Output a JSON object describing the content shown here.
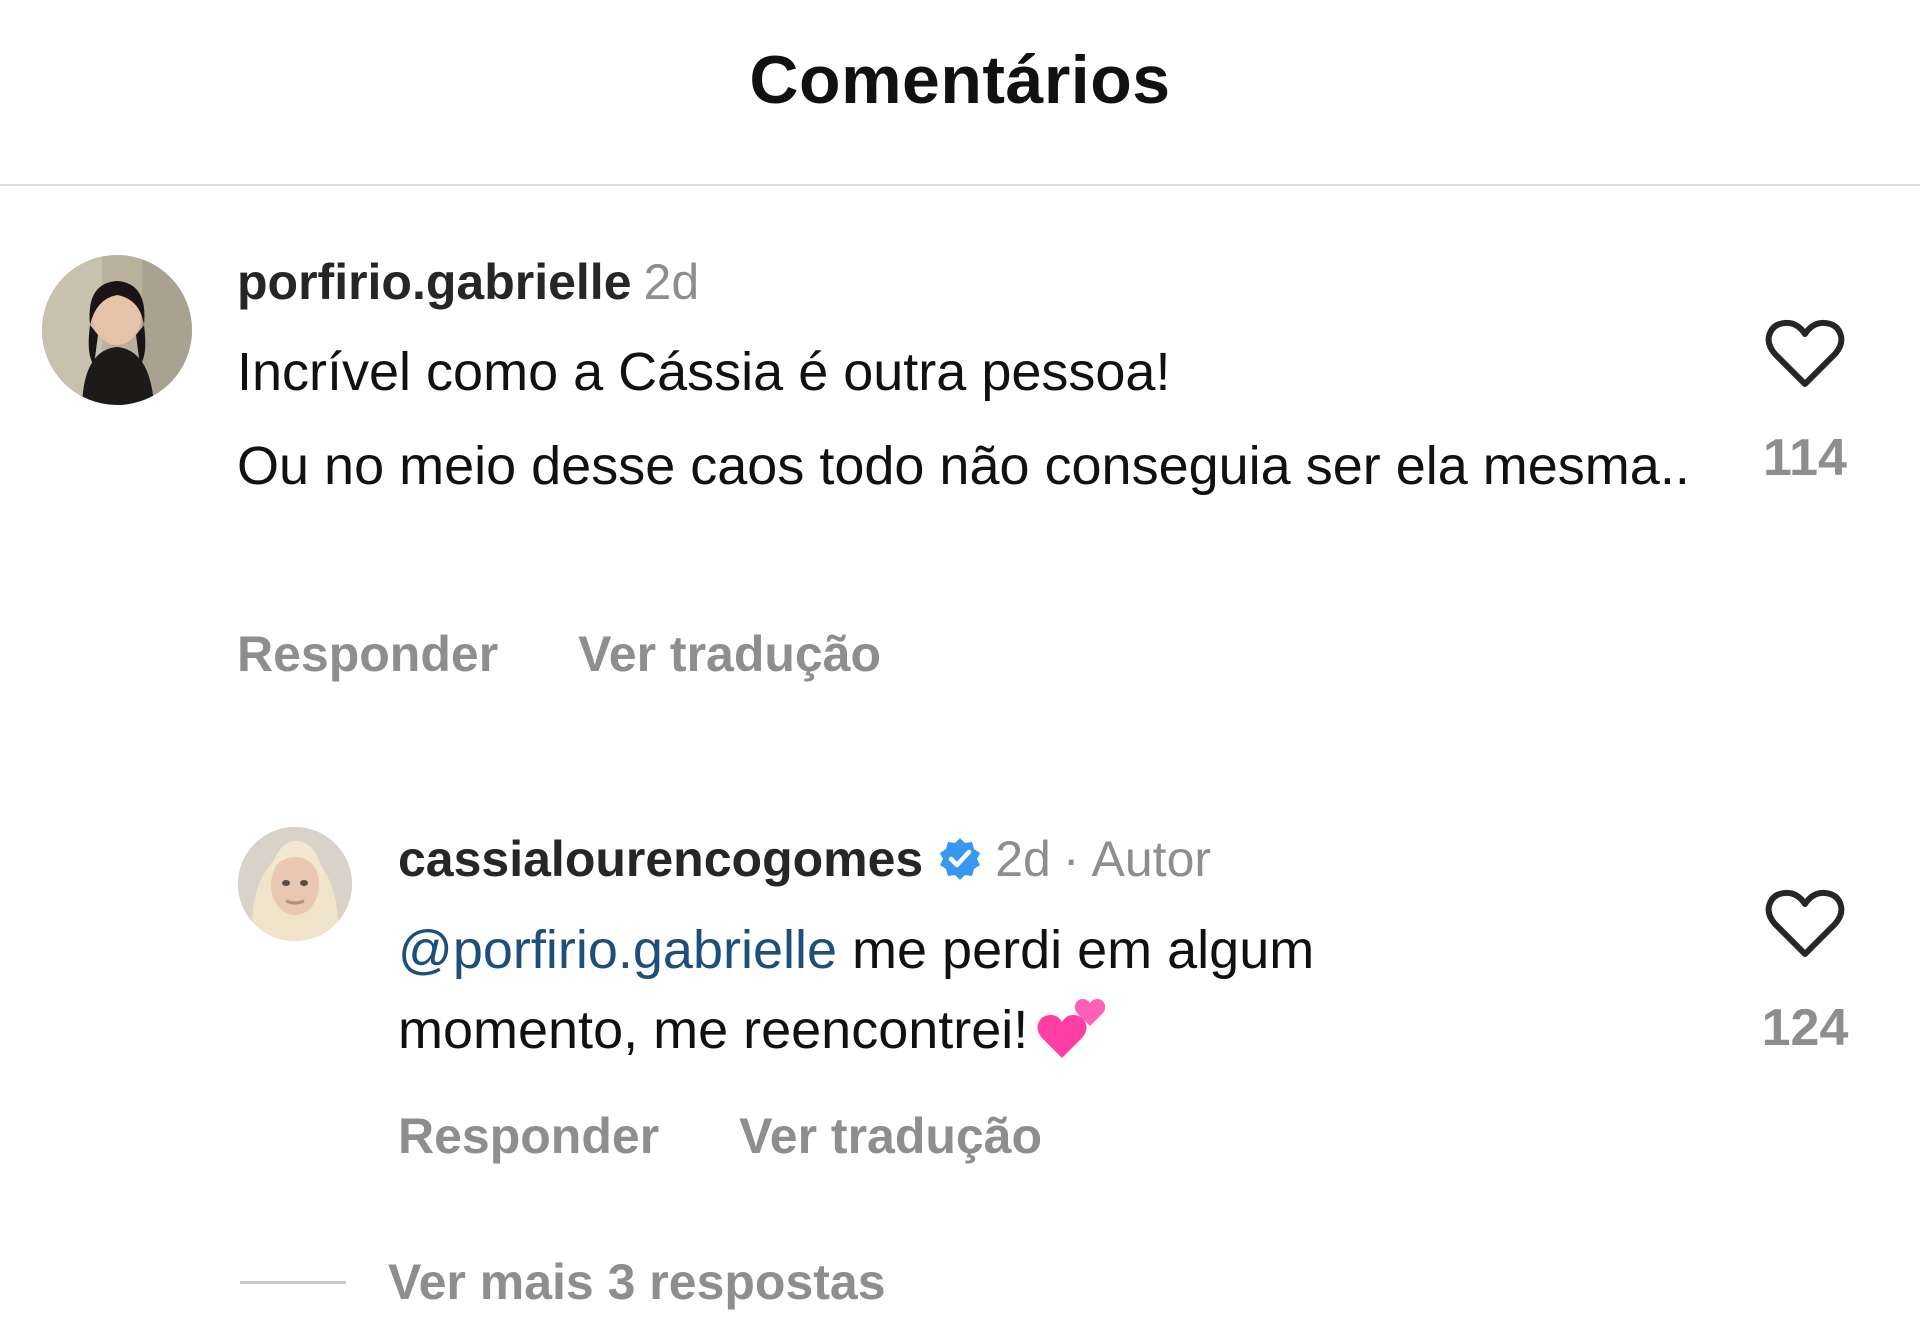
{
  "header": {
    "title": "Comentários"
  },
  "comments": [
    {
      "username": "porfirio.gabrielle",
      "time": "2d",
      "lines": [
        "Incrível como a Cássia é outra pessoa!",
        "Ou no meio desse caos todo não conseguia ser ela mesma.."
      ],
      "likes": "114",
      "reply_label": "Responder",
      "translate_label": "Ver tradução"
    },
    {
      "username": "cassialourencogomes",
      "verified": true,
      "time": "2d",
      "separator": "·",
      "author_label": "Autor",
      "mention": "@porfirio.gabrielle",
      "text_after_mention": " me perdi em algum",
      "text_line2": "momento, me reencontrei!",
      "emoji": "two-hearts-emoji",
      "likes": "124",
      "reply_label": "Responder",
      "translate_label": "Ver tradução"
    }
  ],
  "more_replies": {
    "label": "Ver mais 3 respostas"
  },
  "colors": {
    "mention": "#1e4f7a",
    "muted": "#8e8e8e",
    "verified": "#3897f0",
    "heart_emoji": "#ff3fa4"
  }
}
